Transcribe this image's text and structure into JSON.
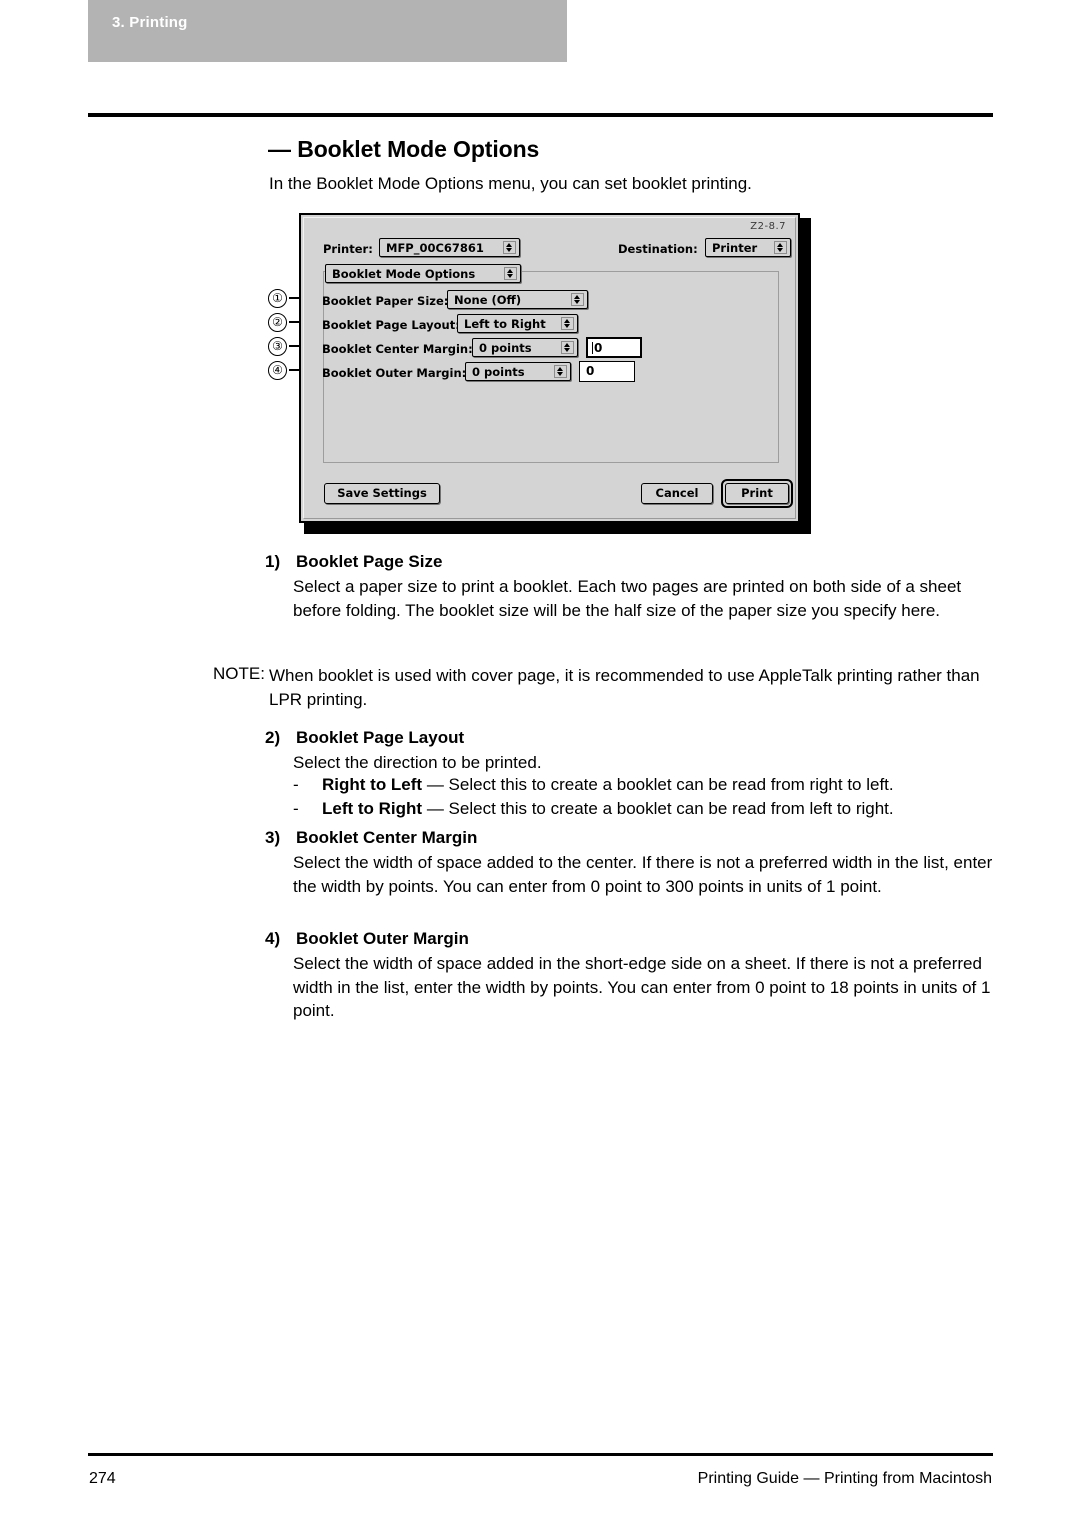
{
  "header": {
    "chapter": "3. Printing"
  },
  "section": {
    "heading": "— Booklet Mode Options",
    "intro": "In the Booklet Mode Options menu, you can set booklet printing."
  },
  "dialog": {
    "version_tag": "Z2-8.7",
    "printer_label": "Printer:",
    "printer_value": "MFP_00C67861",
    "destination_label": "Destination:",
    "destination_value": "Printer",
    "pane_popup_value": "Booklet Mode Options",
    "rows": [
      {
        "label": "Booklet Paper Size:",
        "value": "None (Off)"
      },
      {
        "label": "Booklet Page Layout:",
        "value": "Left to Right"
      },
      {
        "label": "Booklet Center Margin:",
        "value": "0 points",
        "field": "0"
      },
      {
        "label": "Booklet Outer Margin:",
        "value": "0 points",
        "field": "0"
      }
    ],
    "buttons": {
      "save": "Save Settings",
      "cancel": "Cancel",
      "print": "Print"
    }
  },
  "callouts": [
    "①",
    "②",
    "③",
    "④"
  ],
  "body": {
    "item1": {
      "num": "1)",
      "title": "Booklet Page Size",
      "text": "Select a paper size to print a booklet.  Each two pages are printed on both side of a sheet before folding.  The booklet size will be the half size of the paper size you specify here."
    },
    "note": {
      "label": "NOTE:",
      "text": "When booklet is used with cover page, it is recommended to use AppleTalk printing rather than LPR printing."
    },
    "item2": {
      "num": "2)",
      "title": "Booklet Page Layout",
      "text": "Select the direction to be printed.",
      "bullets": [
        {
          "dash": "-",
          "term": "Right to Left",
          "desc": "— Select this to create a booklet can be read from right to left."
        },
        {
          "dash": "-",
          "term": "Left to Right",
          "desc": "— Select this to create a booklet can be read from left to right."
        }
      ]
    },
    "item3": {
      "num": "3)",
      "title": "Booklet Center Margin",
      "text": "Select the width of space added to the center.  If there is not a preferred width in the list, enter the width by points.  You can enter from 0 point to 300 points in units of 1 point."
    },
    "item4": {
      "num": "4)",
      "title": "Booklet Outer Margin",
      "text": "Select the width of space added in the short-edge side on a sheet.  If there is not a preferred width in the list, enter the width by points.  You can enter from 0 point to 18 points in units of 1 point."
    }
  },
  "footer": {
    "page_number": "274",
    "text": "Printing Guide — Printing from Macintosh"
  }
}
